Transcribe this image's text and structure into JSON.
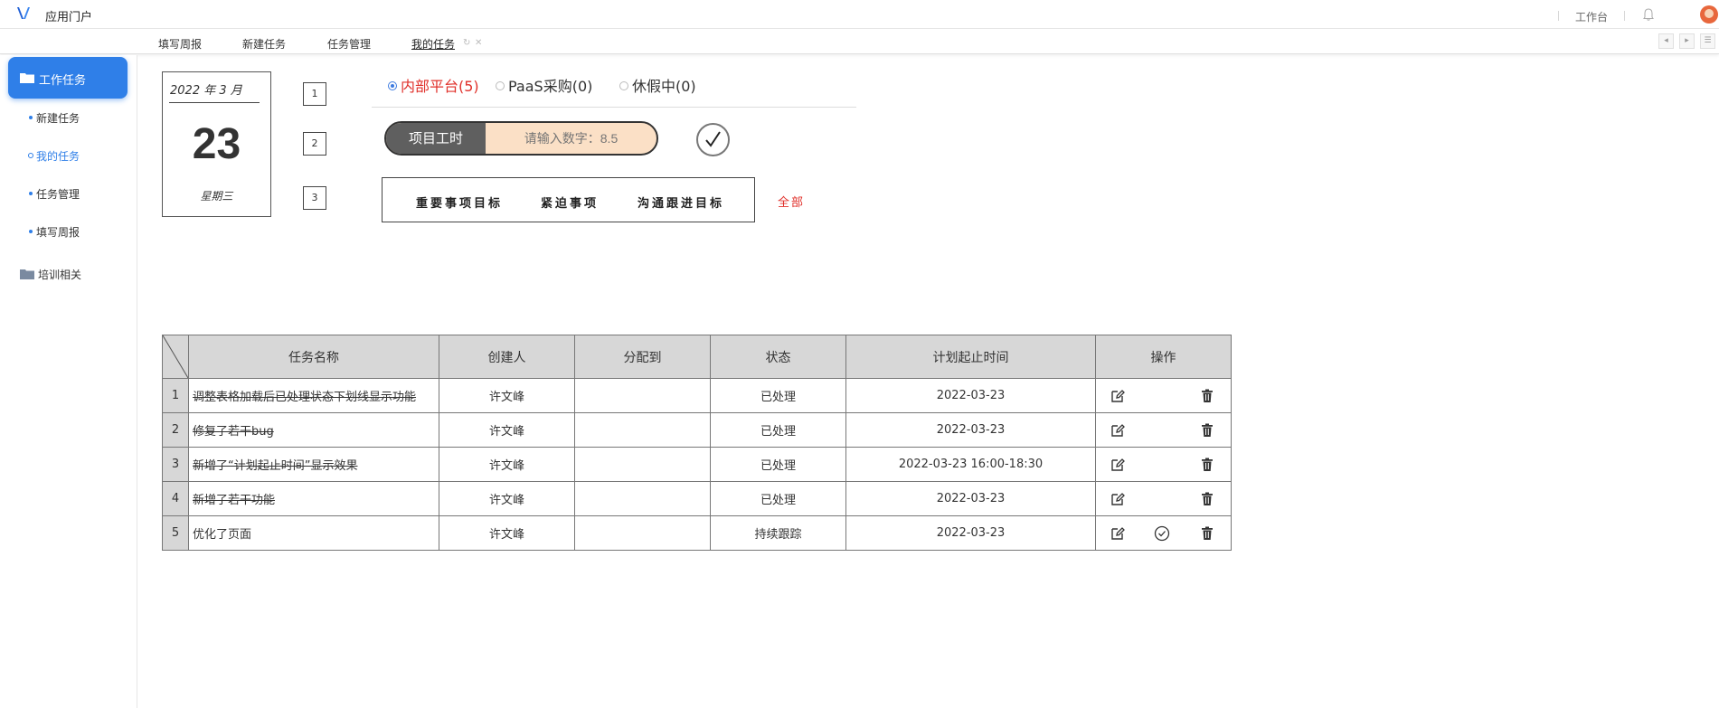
{
  "header": {
    "app_title": "应用门户",
    "workbench": "工作台"
  },
  "tabs": [
    {
      "label": "填写周报"
    },
    {
      "label": "新建任务"
    },
    {
      "label": "任务管理"
    },
    {
      "label": "我的任务",
      "active": true
    }
  ],
  "sidebar": {
    "group1": "工作任务",
    "items": [
      {
        "label": "新建任务"
      },
      {
        "label": "我的任务",
        "active": true
      },
      {
        "label": "任务管理"
      },
      {
        "label": "填写周报"
      }
    ],
    "group2": "培训相关"
  },
  "calendar": {
    "year_month": "2022 年    3 月",
    "day": "23",
    "weekday": "星期三"
  },
  "step_boxes": [
    "1",
    "2",
    "3"
  ],
  "radios": [
    {
      "label": "内部平台(5)",
      "checked": true
    },
    {
      "label": "PaaS采购(0)",
      "checked": false
    },
    {
      "label": "休假中(0)",
      "checked": false
    }
  ],
  "hours": {
    "label": "项目工时",
    "placeholder": "请输入数字：8.5"
  },
  "filters": [
    "重要事项目标",
    "紧迫事项",
    "沟通跟进目标"
  ],
  "filter_all": "全部",
  "table": {
    "headers": [
      "任务名称",
      "创建人",
      "分配到",
      "状态",
      "计划起止时间",
      "操作"
    ],
    "rows": [
      {
        "idx": "1",
        "name": "调整表格加载后已处理状态下划线显示功能",
        "creator": "许文峰",
        "assignee": "",
        "status": "已处理",
        "time": "2022-03-23",
        "done": true
      },
      {
        "idx": "2",
        "name": "修复了若干bug",
        "creator": "许文峰",
        "assignee": "",
        "status": "已处理",
        "time": "2022-03-23",
        "done": true
      },
      {
        "idx": "3",
        "name": "新增了“计划起止时间”显示效果",
        "creator": "许文峰",
        "assignee": "",
        "status": "已处理",
        "time": "2022-03-23 16:00-18:30",
        "done": true
      },
      {
        "idx": "4",
        "name": "新增了若干功能",
        "creator": "许文峰",
        "assignee": "",
        "status": "已处理",
        "time": "2022-03-23",
        "done": true
      },
      {
        "idx": "5",
        "name": "优化了页面",
        "creator": "许文峰",
        "assignee": "",
        "status": "持续跟踪",
        "time": "2022-03-23",
        "done": false
      }
    ]
  },
  "colors": {
    "accent": "#2f7fe8",
    "alert_red": "#e0302a",
    "hours_input_bg": "#fbe0c6",
    "table_header_bg": "#d7d7d7"
  },
  "icons": [
    "logo-icon",
    "bell-icon",
    "avatar",
    "folder-icon",
    "checkmark-icon",
    "edit-icon",
    "check-circle-icon",
    "trash-icon"
  ]
}
